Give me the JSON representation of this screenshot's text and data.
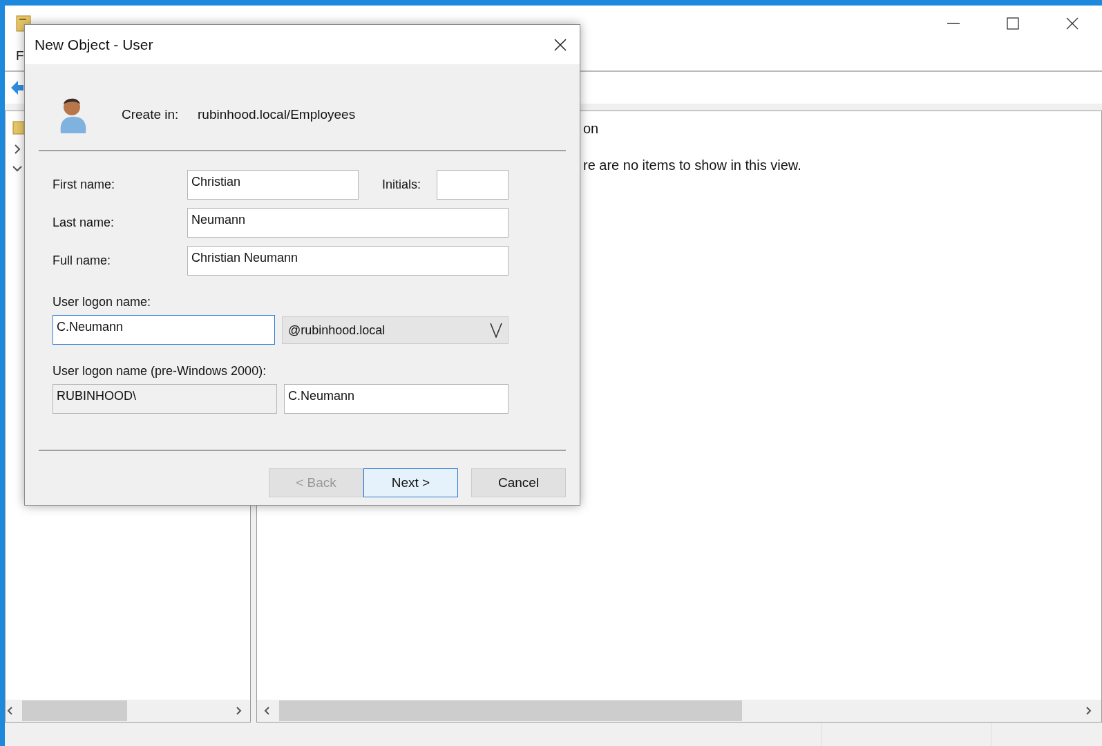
{
  "app_window": {
    "menu_item": "F",
    "details_heading": "on",
    "empty_message": "re are no items to show in this view."
  },
  "dialog": {
    "title": "New Object - User",
    "create_in_label": "Create in:",
    "create_in_value": "rubinhood.local/Employees",
    "first_name": {
      "label": "First name:",
      "value": "Christian"
    },
    "initials": {
      "label": "Initials:"
    },
    "last_name": {
      "label": "Last name:",
      "value": "Neumann"
    },
    "full_name": {
      "label": "Full name:",
      "value": "Christian Neumann"
    },
    "logon": {
      "label": "User logon name:",
      "value": "C.Neumann",
      "focused": true,
      "domain": "@rubinhood.local"
    },
    "pre2000": {
      "label": "User logon name (pre-Windows 2000):",
      "domain": "RUBINHOOD\\",
      "value": "C.Neumann"
    },
    "buttons": [
      {
        "label": "< Back",
        "disabled": true,
        "default": false
      },
      {
        "label": "Next >",
        "disabled": false,
        "default": true
      },
      {
        "label": "Cancel",
        "disabled": false,
        "default": false
      }
    ]
  }
}
